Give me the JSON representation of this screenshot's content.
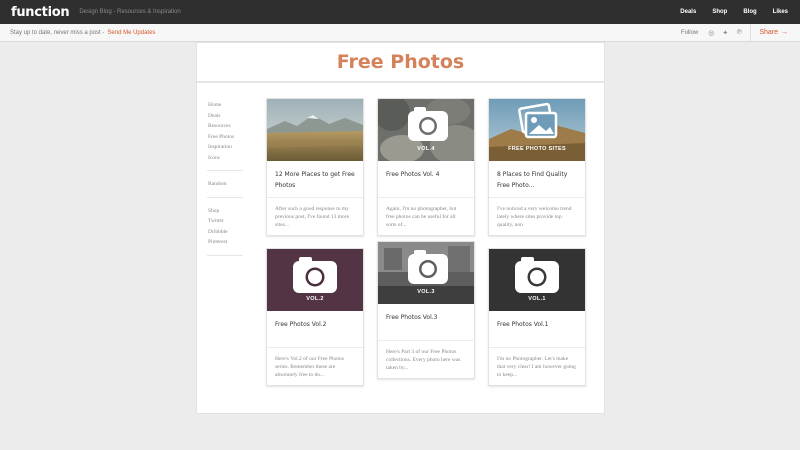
{
  "topbar": {
    "logo": "function",
    "tagline": "Design Blog - Resources & Inspiration",
    "nav": [
      "Deals",
      "Shop",
      "Blog",
      "Likes"
    ]
  },
  "subbar": {
    "text": "Stay up to date, never miss a post -",
    "link": "Send Me Updates",
    "follow": "Follow",
    "share": "Share",
    "share_arrow": "→",
    "social_icons": [
      "dribbble-icon",
      "twitter-icon",
      "pinterest-icon"
    ],
    "social_glyphs": [
      "◎",
      "✦",
      "℗"
    ]
  },
  "page": {
    "title": "Free Photos"
  },
  "sidebar": {
    "group1": [
      "Home",
      "Deals",
      "Resources",
      "Free Photos",
      "Inspiration",
      "Icons"
    ],
    "group2": [
      "Random"
    ],
    "group3": [
      "Shop",
      "Twitter",
      "Dribbble",
      "Pinterest"
    ]
  },
  "cards": [
    {
      "title": "12 More Places to get Free Photos",
      "desc": "After such a good response to my previous post, I've found 13 more sites...",
      "thumb_label": ""
    },
    {
      "title": "Free Photos Vol. 4",
      "desc": "Again, I'm no photographer, but free photos can be useful for all sorts of...",
      "thumb_label": "VOL.4"
    },
    {
      "title": "8 Places to Find Quality Free Photo...",
      "desc": "I've noticed a very welcome trend lately where sites provide top quality, non",
      "thumb_label": "FREE PHOTO SITES"
    },
    {
      "title": "Free Photos Vol.2",
      "desc": "Here's Vol.2 of our Free Photos series. Remember these are absolutely free to do...",
      "thumb_label": "VOL.2"
    },
    {
      "title": "Free Photos Vol.3",
      "desc": "Here's Part 3 of our Free Photos collections. Every photo here was taken by...",
      "thumb_label": "VOL.3"
    },
    {
      "title": "Free Photos Vol.1",
      "desc": "I'm no Photographer. Let's make that very clear! I am however going to keep...",
      "thumb_label": "VOL.1"
    }
  ],
  "colors": {
    "accent": "#d4572a",
    "title": "#d4825a",
    "topbar": "#2f2f2f"
  }
}
